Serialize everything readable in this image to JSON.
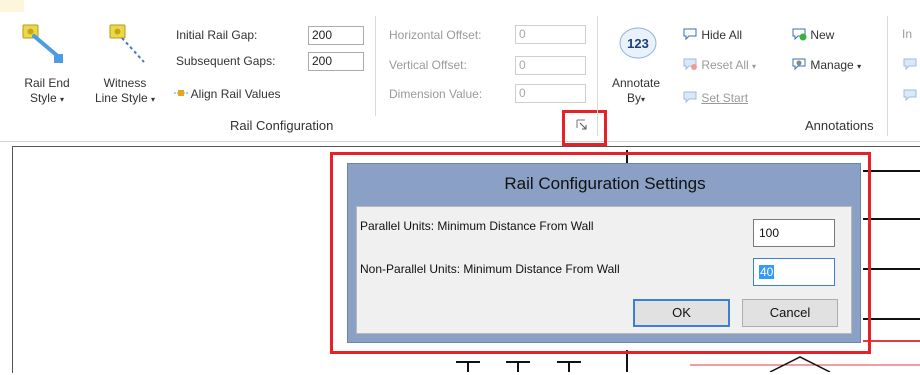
{
  "ribbon": {
    "rail_end_style": {
      "line1": "Rail End",
      "line2": "Style"
    },
    "witness_line_style": {
      "line1": "Witness",
      "line2": "Line Style"
    },
    "initial_rail_gap": {
      "label": "Initial Rail Gap:",
      "value": "200"
    },
    "subsequent_gaps": {
      "label": "Subsequent Gaps:",
      "value": "200"
    },
    "align_rail_values": "Align Rail Values",
    "horizontal_offset": {
      "label": "Horizontal Offset:",
      "value": "0"
    },
    "vertical_offset": {
      "label": "Vertical Offset:",
      "value": "0"
    },
    "dimension_value": {
      "label": "Dimension Value:",
      "value": "0"
    },
    "group_rail_configuration": "Rail Configuration",
    "annotate_by": {
      "badge": "123",
      "line1": "Annotate",
      "line2": "By"
    },
    "hide_all": "Hide All",
    "reset_all": "Reset All",
    "set_start": "Set Start",
    "new": "New",
    "manage": "Manage",
    "group_annotations": "Annotations",
    "next_group_partial": "In"
  },
  "dialog": {
    "title": "Rail Configuration Settings",
    "parallel": {
      "label": "Parallel Units: Minimum Distance From Wall",
      "value": "100"
    },
    "non_parallel": {
      "label": "Non-Parallel Units: Minimum Distance From Wall",
      "value": "40"
    },
    "ok_label": "OK",
    "cancel_label": "Cancel"
  },
  "colors": {
    "highlight_red": "#e8202a",
    "dialog_frame": "#8aa0c4",
    "selection": "#3399ff"
  }
}
